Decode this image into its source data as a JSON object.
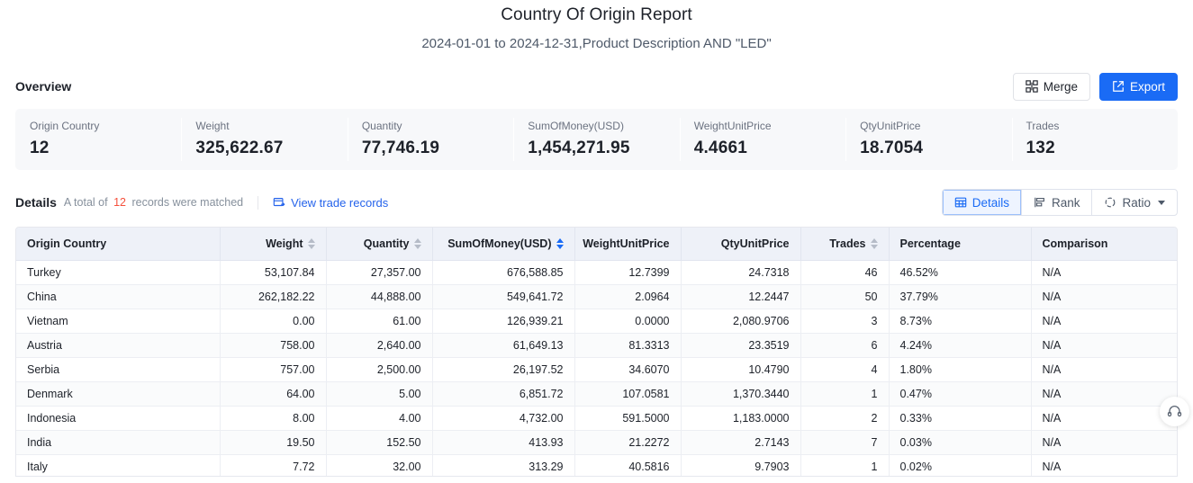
{
  "report": {
    "title": "Country Of Origin Report",
    "subtitle": "2024-01-01 to 2024-12-31,Product Description AND \"LED\""
  },
  "overview": {
    "label": "Overview",
    "merge_label": "Merge",
    "export_label": "Export",
    "merge_icon": "merge-grid-icon",
    "export_icon": "external-link-icon",
    "cards": [
      {
        "label": "Origin Country",
        "value": "12"
      },
      {
        "label": "Weight",
        "value": "325,622.67"
      },
      {
        "label": "Quantity",
        "value": "77,746.19"
      },
      {
        "label": "SumOfMoney(USD)",
        "value": "1,454,271.95"
      },
      {
        "label": "WeightUnitPrice",
        "value": "4.4661"
      },
      {
        "label": "QtyUnitPrice",
        "value": "18.7054"
      },
      {
        "label": "Trades",
        "value": "132"
      }
    ]
  },
  "details": {
    "title": "Details",
    "meta_prefix": "A total of",
    "count": "12",
    "meta_suffix": "records were matched",
    "view_trade_records": "View trade records",
    "view_trade_icon": "records-list-icon",
    "view_modes": [
      {
        "label": "Details",
        "icon": "table-grid-icon",
        "active": true
      },
      {
        "label": "Rank",
        "icon": "rank-bars-icon",
        "active": false
      },
      {
        "label": "Ratio",
        "icon": "ratio-circle-icon",
        "active": false,
        "has_caret": true
      }
    ]
  },
  "table": {
    "columns": [
      {
        "key": "country",
        "label": "Origin Country",
        "align": "left",
        "sortable": false,
        "sorted": false
      },
      {
        "key": "weight",
        "label": "Weight",
        "align": "right",
        "sortable": true,
        "sorted": false
      },
      {
        "key": "qty",
        "label": "Quantity",
        "align": "right",
        "sortable": true,
        "sorted": false
      },
      {
        "key": "sum",
        "label": "SumOfMoney(USD)",
        "align": "right",
        "sortable": true,
        "sorted": true
      },
      {
        "key": "wup",
        "label": "WeightUnitPrice",
        "align": "right",
        "sortable": false,
        "sorted": false
      },
      {
        "key": "qup",
        "label": "QtyUnitPrice",
        "align": "right",
        "sortable": false,
        "sorted": false
      },
      {
        "key": "trades",
        "label": "Trades",
        "align": "right",
        "sortable": true,
        "sorted": false
      },
      {
        "key": "pct",
        "label": "Percentage",
        "align": "left",
        "sortable": false,
        "sorted": false
      },
      {
        "key": "comp",
        "label": "Comparison",
        "align": "left",
        "sortable": false,
        "sorted": false
      }
    ],
    "rows": [
      {
        "country": "Turkey",
        "weight": "53,107.84",
        "qty": "27,357.00",
        "sum": "676,588.85",
        "wup": "12.7399",
        "qup": "24.7318",
        "trades": "46",
        "pct": "46.52%",
        "comp": "N/A"
      },
      {
        "country": "China",
        "weight": "262,182.22",
        "qty": "44,888.00",
        "sum": "549,641.72",
        "wup": "2.0964",
        "qup": "12.2447",
        "trades": "50",
        "pct": "37.79%",
        "comp": "N/A"
      },
      {
        "country": "Vietnam",
        "weight": "0.00",
        "qty": "61.00",
        "sum": "126,939.21",
        "wup": "0.0000",
        "qup": "2,080.9706",
        "trades": "3",
        "pct": "8.73%",
        "comp": "N/A"
      },
      {
        "country": "Austria",
        "weight": "758.00",
        "qty": "2,640.00",
        "sum": "61,649.13",
        "wup": "81.3313",
        "qup": "23.3519",
        "trades": "6",
        "pct": "4.24%",
        "comp": "N/A"
      },
      {
        "country": "Serbia",
        "weight": "757.00",
        "qty": "2,500.00",
        "sum": "26,197.52",
        "wup": "34.6070",
        "qup": "10.4790",
        "trades": "4",
        "pct": "1.80%",
        "comp": "N/A"
      },
      {
        "country": "Denmark",
        "weight": "64.00",
        "qty": "5.00",
        "sum": "6,851.72",
        "wup": "107.0581",
        "qup": "1,370.3440",
        "trades": "1",
        "pct": "0.47%",
        "comp": "N/A"
      },
      {
        "country": "Indonesia",
        "weight": "8.00",
        "qty": "4.00",
        "sum": "4,732.00",
        "wup": "591.5000",
        "qup": "1,183.0000",
        "trades": "2",
        "pct": "0.33%",
        "comp": "N/A"
      },
      {
        "country": "India",
        "weight": "19.50",
        "qty": "152.50",
        "sum": "413.93",
        "wup": "21.2272",
        "qup": "2.7143",
        "trades": "7",
        "pct": "0.03%",
        "comp": "N/A"
      },
      {
        "country": "Italy",
        "weight": "7.72",
        "qty": "32.00",
        "sum": "313.29",
        "wup": "40.5816",
        "qup": "9.7903",
        "trades": "1",
        "pct": "0.02%",
        "comp": "N/A"
      }
    ]
  },
  "support": {
    "icon": "headset-icon"
  },
  "colors": {
    "primary": "#1a6bf5",
    "link": "#2563eb",
    "count_highlight": "#f5503c",
    "card_bg": "#f7f8fa",
    "table_header_bg": "#eef1f8"
  }
}
